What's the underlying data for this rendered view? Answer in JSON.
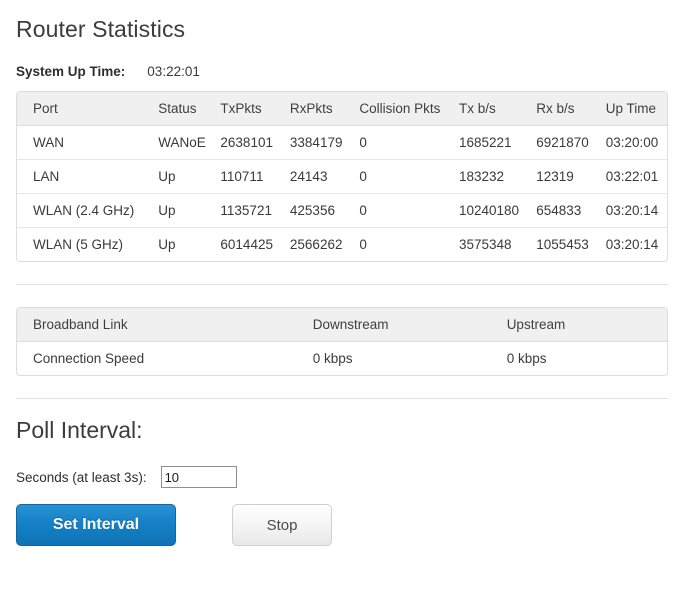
{
  "page": {
    "title": "Router Statistics"
  },
  "system": {
    "uptime_label": "System Up Time:",
    "uptime_value": "03:22:01"
  },
  "stats_table": {
    "headers": [
      "Port",
      "Status",
      "TxPkts",
      "RxPkts",
      "Collision Pkts",
      "Tx b/s",
      "Rx b/s",
      "Up Time"
    ],
    "rows": [
      {
        "port": "WAN",
        "status": "WANoE",
        "txpkts": "2638101",
        "rxpkts": "3384179",
        "collision": "0",
        "txbs": "1685221",
        "rxbs": "6921870",
        "uptime": "03:20:00"
      },
      {
        "port": "LAN",
        "status": "Up",
        "txpkts": "110711",
        "rxpkts": "24143",
        "collision": "0",
        "txbs": "183232",
        "rxbs": "12319",
        "uptime": "03:22:01"
      },
      {
        "port": "WLAN (2.4 GHz)",
        "status": "Up",
        "txpkts": "1135721",
        "rxpkts": "425356",
        "collision": "0",
        "txbs": "10240180",
        "rxbs": "654833",
        "uptime": "03:20:14"
      },
      {
        "port": "WLAN (5 GHz)",
        "status": "Up",
        "txpkts": "6014425",
        "rxpkts": "2566262",
        "collision": "0",
        "txbs": "3575348",
        "rxbs": "1055453",
        "uptime": "03:20:14"
      }
    ]
  },
  "broadband_table": {
    "headers": [
      "Broadband Link",
      "Downstream",
      "Upstream"
    ],
    "rows": [
      {
        "name": "Connection Speed",
        "downstream": "0 kbps",
        "upstream": "0 kbps"
      }
    ]
  },
  "poll": {
    "section_title": "Poll Interval:",
    "seconds_label": "Seconds (at least 3s):",
    "seconds_value": "10",
    "set_button_label": "Set Interval",
    "stop_button_label": "Stop"
  },
  "colors": {
    "accent_blue": "#1581c6",
    "header_bg": "#f0f0f0",
    "border": "#dddddd",
    "text": "#3a3a3a"
  }
}
